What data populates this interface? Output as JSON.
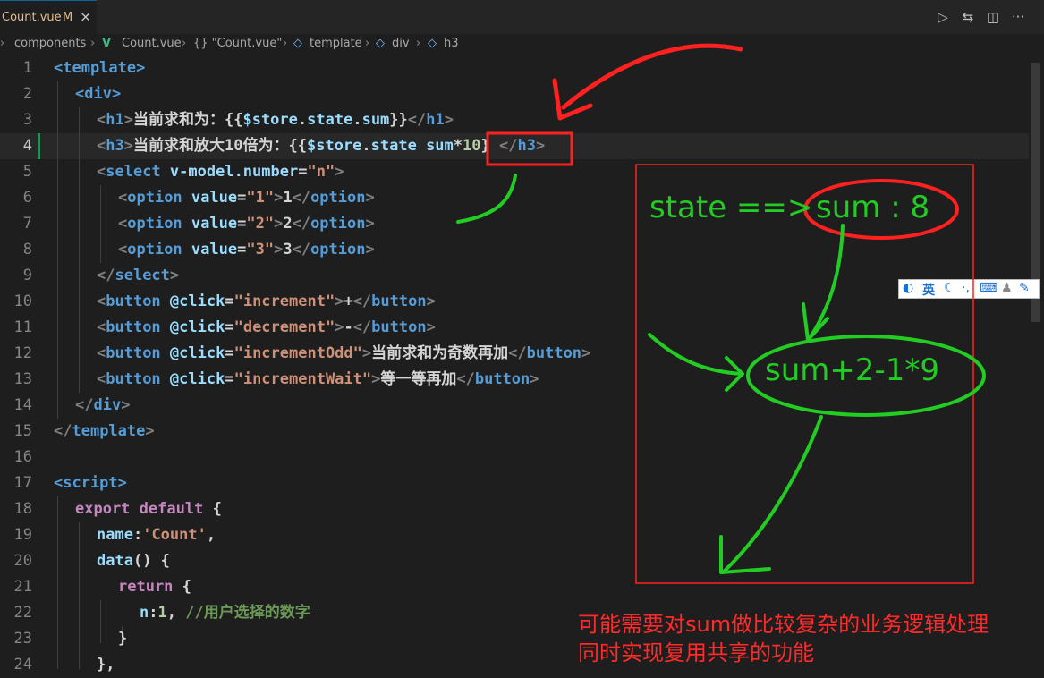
{
  "tab": {
    "filename": "Count.vue",
    "status": "M",
    "close": "×"
  },
  "toolbar_icons": [
    "run-icon",
    "split-compare-icon",
    "split-editor-icon",
    "more-icon"
  ],
  "breadcrumbs": [
    "components",
    "Count.vue",
    "{} \"Count.vue\"",
    "template",
    "div",
    "h3"
  ],
  "code": {
    "current_line": 4,
    "lines": [
      {
        "n": "1"
      },
      {
        "n": "2"
      },
      {
        "n": "3"
      },
      {
        "n": "4"
      },
      {
        "n": "5"
      },
      {
        "n": "6"
      },
      {
        "n": "7"
      },
      {
        "n": "8"
      },
      {
        "n": "9"
      },
      {
        "n": "10"
      },
      {
        "n": "11"
      },
      {
        "n": "12"
      },
      {
        "n": "13"
      },
      {
        "n": "14"
      },
      {
        "n": "15"
      },
      {
        "n": "16"
      },
      {
        "n": "17"
      },
      {
        "n": "18"
      },
      {
        "n": "19"
      },
      {
        "n": "20"
      },
      {
        "n": "21"
      },
      {
        "n": "22"
      },
      {
        "n": "23"
      },
      {
        "n": "24"
      }
    ],
    "text": {
      "l1": "<template>",
      "l2": "<div>",
      "l3_tag": "h1",
      "l3_text": "当前求和为：",
      "l3_expr_a": "{{",
      "l3_var": "$store",
      "l3_dot1": ".",
      "l3_p1": "state",
      "l3_dot2": ".",
      "l3_p2": "sum",
      "l3_expr_b": "}}",
      "l3_close": "h1",
      "l4_tag": "h3",
      "l4_text": "当前求和放大10倍为：",
      "l4_expr_a": "{{",
      "l4_var": "$store",
      "l4_dot1": ".",
      "l4_p1": "state",
      "l4_sp": " ",
      "l4_p2": "sum",
      "l4_op": "*",
      "l4_num": "10",
      "l4_expr_b": "}",
      "l4_close": "h3",
      "l5_tag": "select",
      "l5_attr": "v-model.number",
      "l5_val": "\"n\"",
      "opt_tag": "option",
      "opt_attr": "value",
      "l6_val": "\"1\"",
      "l6_text": "1",
      "l7_val": "\"2\"",
      "l7_text": "2",
      "l8_val": "\"3\"",
      "l8_text": "3",
      "l9": "select",
      "btn_tag": "button",
      "btn_attr": "@click",
      "l10_val": "\"increment\"",
      "l10_text": "+",
      "l11_val": "\"decrement\"",
      "l11_text": "-",
      "l12_val": "\"incrementOdd\"",
      "l12_text": "当前求和为奇数再加",
      "l13_val": "\"incrementWait\"",
      "l13_text": "等一等再加",
      "l14": "div",
      "l15": "template",
      "l17": "<script>",
      "l18_kw1": "export",
      "l18_kw2": "default",
      "l18_br": "{",
      "l19_key": "name",
      "l19_val": "'Count'",
      "l19_end": ",",
      "l20_fn": "data",
      "l20_rest": "() {",
      "l21_kw": "return",
      "l21_br": "{",
      "l22_key": "n",
      "l22_num": "1",
      "l22_cmt": "//用户选择的数字",
      "l23": "}",
      "l24": "},"
    }
  },
  "annotations": {
    "state_text": "state ==>",
    "sum8_text": "sum : 8",
    "expr_text": "sum+2-1*9",
    "note_line1": "可能需要对sum做比较复杂的业务逻辑处理",
    "note_line2": "同时实现复用共享的功能",
    "colors": {
      "red": "#ff2a2a",
      "green": "#22cc22"
    }
  },
  "ime_toolbar": {
    "lang": "英",
    "icons": [
      "moon-icon",
      "punct-icon",
      "keyboard-icon",
      "user-icon",
      "wrench-icon"
    ]
  }
}
